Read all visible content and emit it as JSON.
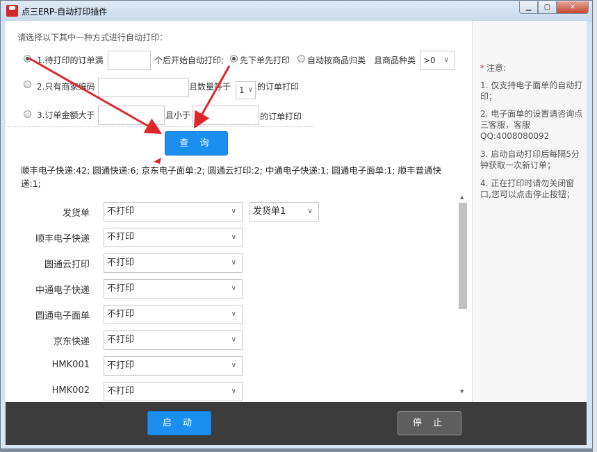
{
  "window": {
    "title": "点三ERP-自动打印插件",
    "icon_text": "AUTO"
  },
  "options": {
    "prompt": "请选择以下其中一种方式进行自动打印：",
    "opt1": {
      "label": "1.待打印的订单满",
      "suffix": "个后开始自动打印;",
      "selected": true
    },
    "first_order_label": "先下单先打印",
    "by_product_label": "自动按商品归类",
    "kinds_label": "且商品种类",
    "kinds_value": ">0",
    "opt2": {
      "label": "2.只有商家编码",
      "mid": "且数量等于",
      "qty_value": "1",
      "suffix": "的订单打印"
    },
    "opt3": {
      "label": "3.订单金额大于",
      "mid": "且小于",
      "suffix": "的订单打印"
    }
  },
  "query_label": "查 询",
  "summary": "顺丰电子快递:42; 圆通快递:6; 京东电子面单:2; 圆通云打印:2; 中通电子快递:1; 圆通电子面单:1; 顺丰普通快递:1;",
  "rows": [
    {
      "label": "发货单",
      "value": "不打印",
      "extra": "发货单1"
    },
    {
      "label": "顺丰电子快递",
      "value": "不打印"
    },
    {
      "label": "圆通云打印",
      "value": "不打印"
    },
    {
      "label": "中通电子快递",
      "value": "不打印"
    },
    {
      "label": "圆通电子面单",
      "value": "不打印"
    },
    {
      "label": "京东快递",
      "value": "不打印"
    },
    {
      "label": "HMK001",
      "value": "不打印"
    },
    {
      "label": "HMK002",
      "value": "不打印"
    }
  ],
  "notes": {
    "heading": "注意:",
    "items": [
      "1. 仅支持电子面单的自动打印；",
      "2. 电子面单的设置请咨询点三客服，客服QQ:4008080092",
      "3. 启动自动打印后每隔5分钟获取一次新订单；",
      "4. 正在打印时请勿关闭窗口,您可以点击停止按钮；"
    ]
  },
  "footer": {
    "start_label": "启 动",
    "stop_label": "停 止"
  },
  "colors": {
    "accent": "#1a8ff0",
    "arrow": "#e0262b",
    "footer_bg": "#3c3c3c"
  }
}
